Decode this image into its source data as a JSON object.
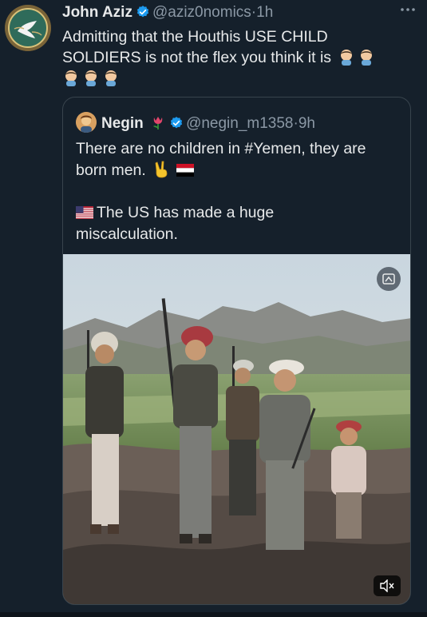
{
  "tweet": {
    "author_name": "John Aziz",
    "handle": "@aziz0nomics",
    "separator": "·",
    "time": "1h",
    "text_line1": "Admitting that the Houthis USE CHILD",
    "text_line2": "SOLDIERS is not the flex you think it is",
    "more_icon": "more-icon"
  },
  "quote": {
    "author_name": "Negin",
    "handle": "@negin_m1358",
    "separator": "·",
    "time": "9h",
    "line1": "There are no children in #Yemen, they are",
    "line2": "born men.",
    "line3": "The US has made a huge",
    "line4": "miscalculation."
  },
  "colors": {
    "background": "#15202b",
    "text": "#e7e9ea",
    "muted": "#8b98a5",
    "verified": "#1d9bf0",
    "border": "#38444d"
  }
}
